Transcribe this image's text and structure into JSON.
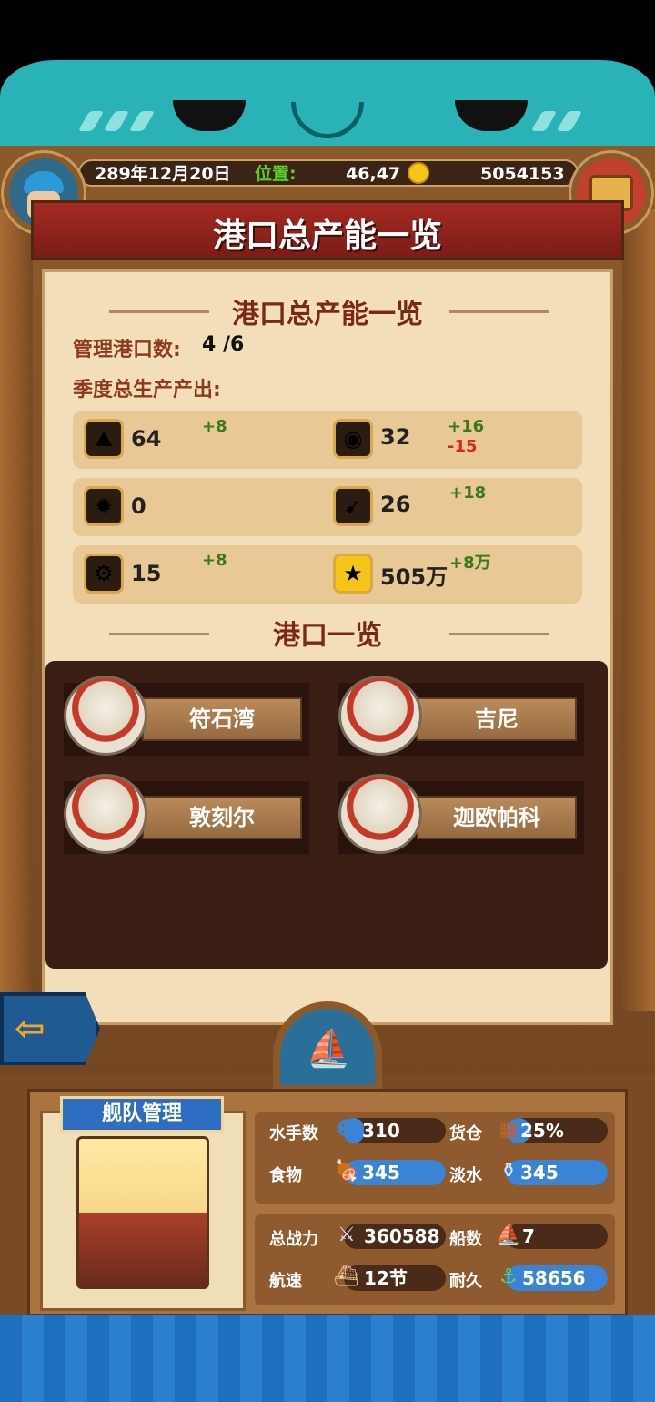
{
  "header": {
    "date": "289年12月20日",
    "location_label": "位置:",
    "coords": "46,47",
    "gold": "5054153",
    "title": "港口总产能一览"
  },
  "summary": {
    "section_title": "港口总产能一览",
    "managed_ports_label": "管理港口数:",
    "managed_ports_value": "4 /6",
    "quarter_output_label": "季度总生产产出:"
  },
  "resources": [
    {
      "icon": "stone-icon",
      "value": "64",
      "plus": "+8",
      "minus": ""
    },
    {
      "icon": "crystal-icon",
      "value": "32",
      "plus": "+16",
      "minus": "-15"
    },
    {
      "icon": "gear-badge-icon",
      "value": "0",
      "plus": "",
      "minus": ""
    },
    {
      "icon": "compass-icon",
      "value": "26",
      "plus": "+18",
      "minus": ""
    },
    {
      "icon": "cog-icon",
      "value": "15",
      "plus": "+8",
      "minus": ""
    },
    {
      "icon": "gold-coin-icon",
      "value": "505万",
      "plus": "+8万",
      "minus": ""
    }
  ],
  "ports": {
    "section_title": "港口一览",
    "items": [
      "符石湾",
      "吉尼",
      "敦刻尔",
      "迦欧帕科"
    ]
  },
  "fleet": {
    "title": "舰队管理",
    "sailors_label": "水手数",
    "sailors_value": "310",
    "sailors_fill": 0.2,
    "cargo_label": "货仓",
    "cargo_value": "25%",
    "cargo_fill": 0.25,
    "food_label": "食物",
    "food_value": "345",
    "food_fill": 1.0,
    "water_label": "淡水",
    "water_value": "345",
    "water_fill": 1.0,
    "power_label": "总战力",
    "power_value": "360588",
    "ships_label": "船数",
    "ships_value": "7",
    "speed_label": "航速",
    "speed_value": "12节",
    "durability_label": "耐久",
    "durability_value": "58656",
    "durability_fill": 1.0
  },
  "colors": {
    "accent_red": "#a52a22",
    "bar_blue": "#3b84d4",
    "plus_green": "#3a7a1a",
    "minus_red": "#e0261a"
  }
}
